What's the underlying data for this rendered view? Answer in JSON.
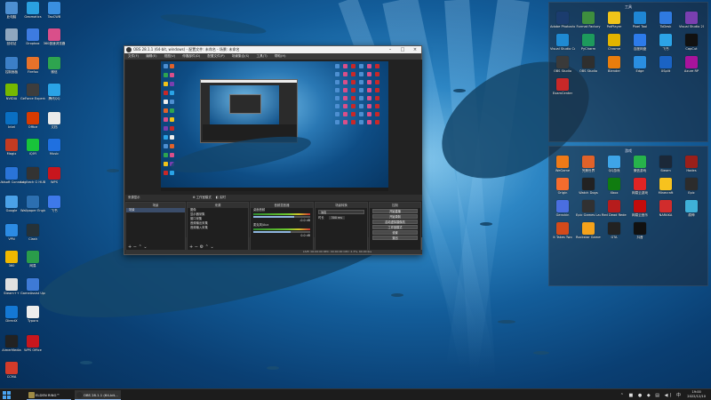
{
  "colors": {
    "desktop": "#135d9a",
    "obs_bg": "#2b2b2b",
    "taskbar": "#1c1c1c",
    "accent_red": "#c23b22"
  },
  "desktop_left": [
    {
      "label": "此电脑",
      "color": "#4d8fd1"
    },
    {
      "label": "Geomatics",
      "color": "#2aa0e0"
    },
    {
      "label": "TaoCWB",
      "color": "#3a8fe0"
    },
    {
      "label": "回收站",
      "color": "#8fa7bf"
    },
    {
      "label": "Dropbox",
      "color": "#3d7be0"
    },
    {
      "label": "360极速浏览器",
      "color": "#d94f8a"
    },
    {
      "label": "控制面板",
      "color": "#3c7fc7"
    },
    {
      "label": "Firefox",
      "color": "#e6722a"
    },
    {
      "label": "微信",
      "color": "#2ea44f"
    },
    {
      "label": "NVIDIA",
      "color": "#76b900"
    },
    {
      "label": "GeForce Experience",
      "color": "#3d3d3d"
    },
    {
      "label": "腾讯QQ",
      "color": "#2aa3e6"
    },
    {
      "label": "Intel",
      "color": "#0a6fc2"
    },
    {
      "label": "Office",
      "color": "#d83b01"
    },
    {
      "label": "文档",
      "color": "#eaeaea"
    },
    {
      "label": "Magix",
      "color": "#c23b22"
    },
    {
      "label": "iQIYI",
      "color": "#18c43a"
    },
    {
      "label": "Music",
      "color": "#1f70e0"
    },
    {
      "label": "Ubisoft Connect",
      "color": "#2a74d8"
    },
    {
      "label": "Logitech G HUB",
      "color": "#333"
    },
    {
      "label": "WPS",
      "color": "#c8161d"
    },
    {
      "label": "Google",
      "color": "#4aa1e8"
    },
    {
      "label": "Wallpaper Engine",
      "color": "#2c6fb0"
    },
    {
      "label": "飞书",
      "color": "#3e79ea"
    },
    {
      "label": "VPN",
      "color": "#2c8be3"
    },
    {
      "label": "Clash",
      "color": "#263238"
    },
    {
      "label": "360",
      "color": "#f0b800"
    },
    {
      "label": "网易",
      "color": "#2a9d4a"
    },
    {
      "label": "Steam++",
      "color": "#e0e0e0"
    },
    {
      "label": "GameAssist Updater",
      "color": "#3e7ad6"
    },
    {
      "label": "DirectX",
      "color": "#1478d4"
    },
    {
      "label": "Typora",
      "color": "#ededed"
    },
    {
      "label": "AimerMedia",
      "color": "#222"
    },
    {
      "label": "WPS Office",
      "color": "#c8161d"
    },
    {
      "label": "CCMA",
      "color": "#d33b2a"
    }
  ],
  "fence_tools": {
    "title": "工具",
    "icons": [
      {
        "label": "Adobe Photoshop",
        "color": "#1b3c6e"
      },
      {
        "label": "Format Factory",
        "color": "#3e8e3e"
      },
      {
        "label": "PotPlayer",
        "color": "#f0c419"
      },
      {
        "label": "Pixel Tool",
        "color": "#1f86d4"
      },
      {
        "label": "ToDesk",
        "color": "#2f7ae0"
      },
      {
        "label": "Visual Studio 2019",
        "color": "#7a3fb0"
      },
      {
        "label": "Visual Studio Code",
        "color": "#1f8ad2"
      },
      {
        "label": "PyCharm",
        "color": "#1d9a5c"
      },
      {
        "label": "Chrome",
        "color": "#e2b400"
      },
      {
        "label": "百度网盘",
        "color": "#2d7bea"
      },
      {
        "label": "飞书",
        "color": "#2ca3e7"
      },
      {
        "label": "CapCut",
        "color": "#111"
      },
      {
        "label": "OBS Studio",
        "color": "#3a3a3a"
      },
      {
        "label": "OBS Studio",
        "color": "#2f2f2f"
      },
      {
        "label": "Blender",
        "color": "#e87d0d"
      },
      {
        "label": "Edge",
        "color": "#2a8ee0"
      },
      {
        "label": "XSplit",
        "color": "#1a63c4"
      },
      {
        "label": "Axure RP",
        "color": "#a8139c"
      },
      {
        "label": "ExamCenter",
        "color": "#c82828"
      }
    ]
  },
  "fence_games": {
    "title": "游戏",
    "icons": [
      {
        "label": "WeGame",
        "color": "#ef7a18"
      },
      {
        "label": "完美世界",
        "color": "#e0622a"
      },
      {
        "label": "QQ游戏",
        "color": "#3ea5e8"
      },
      {
        "label": "微信游戏",
        "color": "#27b34b"
      },
      {
        "label": "Steam",
        "color": "#1b2838"
      },
      {
        "label": "Hades",
        "color": "#9a1f1a"
      },
      {
        "label": "Origin",
        "color": "#f56c2d"
      },
      {
        "label": "Watch Dogs",
        "color": "#222"
      },
      {
        "label": "Xbox",
        "color": "#107c10"
      },
      {
        "label": "网易云游戏",
        "color": "#e02424"
      },
      {
        "label": "Minecraft",
        "color": "#f7c21e"
      },
      {
        "label": "Epic",
        "color": "#2c2c2c"
      },
      {
        "label": "Genshin",
        "color": "#4a6ee0"
      },
      {
        "label": "Epic Games Launcher",
        "color": "#313131"
      },
      {
        "label": "Red Dead Redemption",
        "color": "#b61c1c"
      },
      {
        "label": "网易云音乐",
        "color": "#c20c0c"
      },
      {
        "label": "NARAKA",
        "color": "#d12c2c"
      },
      {
        "label": "原神",
        "color": "#3fb0d8"
      },
      {
        "label": "It Takes Two",
        "color": "#d44a1a"
      },
      {
        "label": "Rockstar Games Launcher",
        "color": "#f4a21b"
      },
      {
        "label": "GTA",
        "color": "#222"
      },
      {
        "label": "抖音",
        "color": "#111"
      }
    ]
  },
  "obs": {
    "title": "OBS 28.1.1 (64-bit, windows) - 配置文件: 未命名 - 场景: 未命名",
    "menu": [
      "文件(F)",
      "编辑(E)",
      "视图(V)",
      "停靠部件(D)",
      "配置文件(P)",
      "场景集合(S)",
      "工具(T)",
      "帮助(H)"
    ],
    "labels": {
      "source_dock": "来源显示",
      "studio": "工作室模式",
      "studio2": "实时",
      "scenes": "场景",
      "sources": "来源",
      "mixer": "音频混音器",
      "transitions": "场景转换",
      "controls": "控制"
    },
    "scenes": [
      "场景"
    ],
    "sources": [
      "图像",
      "显示器采集",
      "窗口采集",
      "音频输出采集",
      "音频输入采集"
    ],
    "mixer": [
      {
        "name": "桌面音频",
        "level": "-0.0 dB",
        "fill": 0.72
      },
      {
        "name": "麦克风/Aux",
        "level": "0.0 dB",
        "fill": 0.66
      }
    ],
    "transition": {
      "type": "淡出",
      "duration_label": "时长",
      "duration": "300 ms"
    },
    "controls": [
      "开始直播",
      "开始录制",
      "启动虚拟摄像机",
      "工作室模式",
      "设置",
      "退出"
    ],
    "status": "LIVE: 00:00:00   REC: 00:00:00   CPU: 2.3%, 60.00 fps"
  },
  "taskbar": {
    "items": [
      {
        "label": "ELDEN RING™",
        "color": "#9f8b45"
      },
      {
        "label": "OBS 28.1.1 (64-bit...",
        "color": "#2a2a2a"
      }
    ],
    "time": "19:00",
    "date": "2022/12/10"
  }
}
